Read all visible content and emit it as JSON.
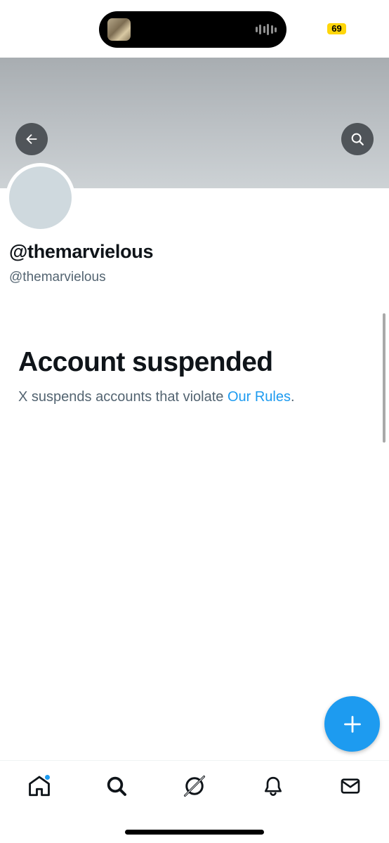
{
  "status_bar": {
    "battery_level": "69",
    "battery_color": "#ffd60a"
  },
  "profile": {
    "display_name": "@themarvielous",
    "handle": "@themarvielous",
    "back_icon": "arrow-left-icon",
    "search_icon": "search-icon"
  },
  "suspension": {
    "title": "Account suspended",
    "message_prefix": "X suspends accounts that violate ",
    "rules_link": "Our Rules",
    "message_suffix": "."
  },
  "fab": {
    "icon": "plus-icon",
    "color": "#1d9bf0"
  },
  "bottom_nav": {
    "items": [
      {
        "name": "home",
        "icon": "home-icon",
        "has_badge": true
      },
      {
        "name": "search",
        "icon": "search-icon"
      },
      {
        "name": "grok",
        "icon": "grok-icon"
      },
      {
        "name": "notifications",
        "icon": "bell-icon"
      },
      {
        "name": "messages",
        "icon": "mail-icon"
      }
    ]
  },
  "colors": {
    "accent": "#1d9bf0",
    "text_primary": "#0f1419",
    "text_secondary": "#536471"
  }
}
